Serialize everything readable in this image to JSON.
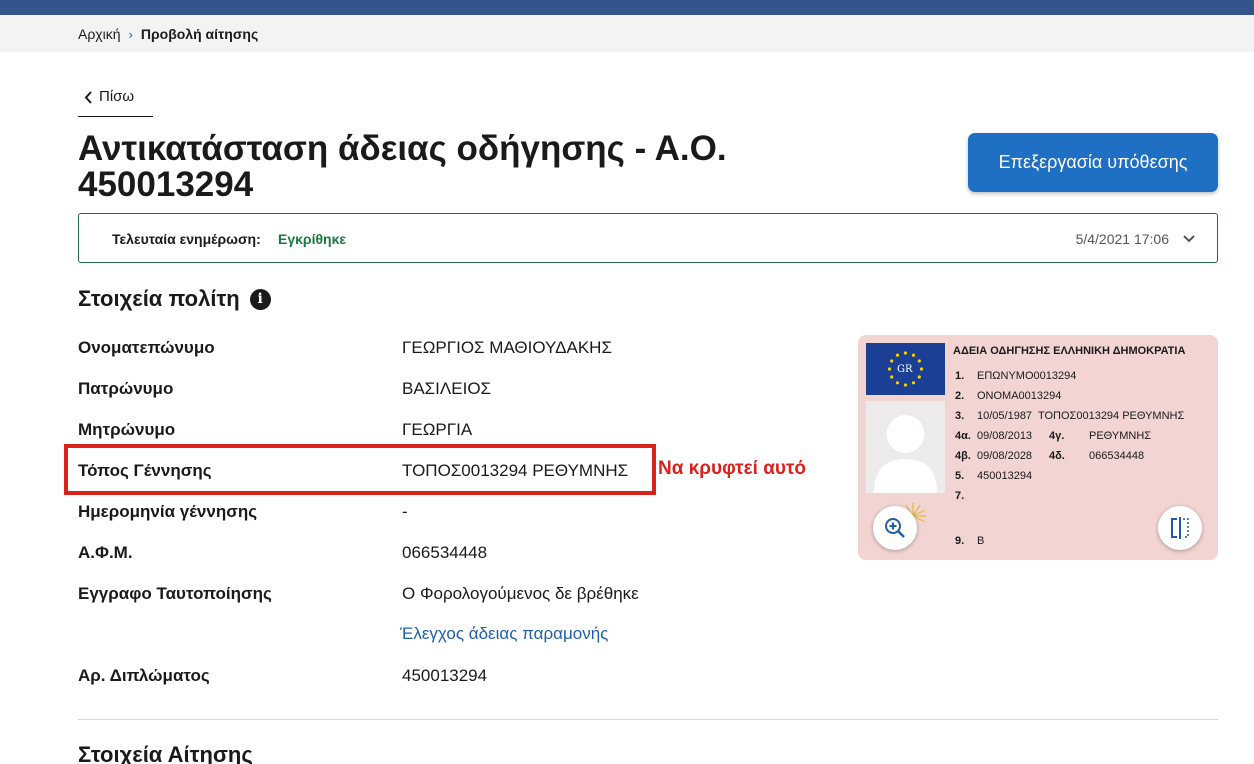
{
  "breadcrumb": {
    "home": "Αρχική",
    "separator": "›",
    "current": "Προβολή αίτησης"
  },
  "back_label": "Πίσω",
  "page_title": "Αντικατάσταση άδειας οδήγησης - Α.Ο. 450013294",
  "process_button": "Επεξεργασία υπόθεσης",
  "status": {
    "label": "Τελευταία ενημέρωση:",
    "value": "Εγκρίθηκε",
    "date": "5/4/2021 17:06"
  },
  "citizen_section": {
    "title": "Στοιχεία πολίτη",
    "info_icon": "i",
    "rows": [
      {
        "label": "Ονοματεπώνυμο",
        "value": "ΓΕΩΡΓΙΟΣ ΜΑΘΙΟΥΔΑΚΗΣ"
      },
      {
        "label": "Πατρώνυμο",
        "value": "ΒΑΣΙΛΕΙΟΣ"
      },
      {
        "label": "Μητρώνυμο",
        "value": "ΓΕΩΡΓΙΑ"
      },
      {
        "label": "Τόπος Γέννησης",
        "value": "ΤΟΠΟΣ0013294 ΡΕΘΥΜΝΗΣ"
      },
      {
        "label": "Ημερομηνία γέννησης",
        "value": "-"
      },
      {
        "label": "Α.Φ.Μ.",
        "value": "066534448"
      },
      {
        "label": "Εγγραφο Ταυτοποίησης",
        "value": "Ο Φορολογούμενος δε βρέθηκε"
      },
      {
        "label": "Αρ. Διπλώματος",
        "value": "450013294"
      }
    ],
    "residence_link": "Έλεγχος άδειας παραμονής"
  },
  "annotation": "Να κρυφτεί αυτό",
  "license_card": {
    "title": "ΑΔΕΙΑ ΟΔΗΓΗΣΗΣ ΕΛΛΗΝΙΚΗ ΔΗΜΟΚΡΑΤΙΑ",
    "country_code": "GR",
    "lines": [
      {
        "num": "1.",
        "text": "ΕΠΩΝΥΜΟ0013294"
      },
      {
        "num": "2.",
        "text": "ΟΝΟΜΑ0013294"
      },
      {
        "num": "3.",
        "text": "10/05/1987  ΤΟΠΟΣ0013294 ΡΕΘΥΜΝΗΣ"
      },
      {
        "num": "4α.",
        "text": "09/08/2013"
      },
      {
        "num": "4β.",
        "text": "09/08/2028"
      },
      {
        "num": "5.",
        "text": "450013294"
      },
      {
        "num": "7.",
        "text": ""
      },
      {
        "num": "9.",
        "text": "B"
      }
    ],
    "extra": [
      {
        "num": "4γ.",
        "text": "ΡΕΘΥΜΝΗΣ"
      },
      {
        "num": "4δ.",
        "text": "066534448"
      }
    ]
  },
  "section2_title": "Στοιχεία Αίτησης",
  "icons": {
    "chevron": "chevron-down-icon",
    "back": "chevron-left-icon",
    "zoom": "zoom-in-icon",
    "flip": "flip-card-icon"
  },
  "colors": {
    "top_bar": "#33558b",
    "primary": "#1f6fc4",
    "approved": "#1b7a3e",
    "highlight": "#d9221c",
    "card_bg": "#f2d4d2"
  }
}
